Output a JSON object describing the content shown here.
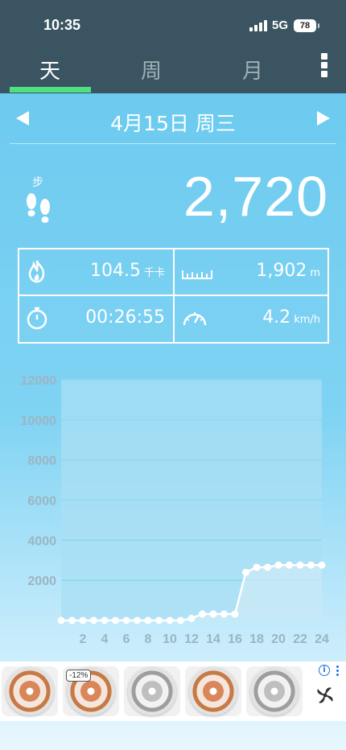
{
  "status": {
    "time": "10:35",
    "network": "5G",
    "battery": "78"
  },
  "tabs": [
    {
      "label": "天",
      "active": true
    },
    {
      "label": "周",
      "active": false
    },
    {
      "label": "月",
      "active": false
    }
  ],
  "date": {
    "label": "4月15日 周三"
  },
  "steps": {
    "label": "步",
    "value": "2,720"
  },
  "stats": {
    "calories": {
      "value": "104.5",
      "unit": "千卡",
      "icon": "flame-icon"
    },
    "distance": {
      "value": "1,902",
      "unit": "m",
      "icon": "ruler-icon"
    },
    "duration": {
      "value": "00:26:55",
      "icon": "stopwatch-icon"
    },
    "speed": {
      "value": "4.2",
      "unit": "km/h",
      "icon": "speedometer-icon"
    }
  },
  "chart_data": {
    "type": "line",
    "x": [
      0,
      1,
      2,
      3,
      4,
      5,
      6,
      7,
      8,
      9,
      10,
      11,
      12,
      13,
      14,
      15,
      16,
      17,
      18,
      19,
      20,
      21,
      22,
      23,
      24
    ],
    "values": [
      0,
      0,
      0,
      0,
      0,
      0,
      0,
      0,
      0,
      0,
      0,
      0,
      100,
      320,
      320,
      320,
      320,
      2400,
      2650,
      2650,
      2760,
      2760,
      2760,
      2760,
      2760
    ],
    "x_tick_labels": [
      "2",
      "4",
      "6",
      "8",
      "10",
      "12",
      "14",
      "16",
      "18",
      "20",
      "22",
      "24"
    ],
    "y_tick_labels": [
      "2000",
      "4000",
      "6000",
      "8000",
      "10000",
      "12000"
    ],
    "ylim": [
      0,
      12000
    ],
    "xlim": [
      0,
      24
    ],
    "grid": true,
    "colors": {
      "line": "#ffffff",
      "grid": "#8fd7f2",
      "plot_bg": "#a9dff4",
      "tick": "#9bb5c2"
    }
  },
  "ad": {
    "discount": "-12%",
    "info": "i",
    "items": [
      {
        "style": "copper"
      },
      {
        "style": "copper"
      },
      {
        "style": "silver"
      },
      {
        "style": "copper"
      },
      {
        "style": "silver"
      }
    ]
  }
}
